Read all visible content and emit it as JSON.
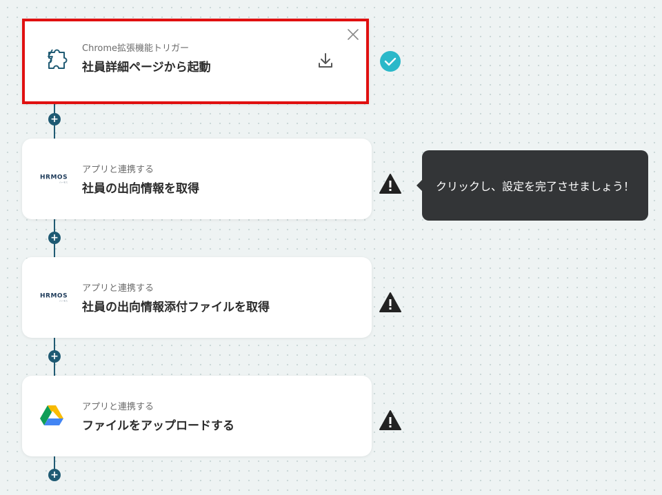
{
  "trigger": {
    "subtitle": "Chrome拡張機能トリガー",
    "title": "社員詳細ページから起動",
    "status": "complete"
  },
  "steps": [
    {
      "subtitle": "アプリと連携する",
      "title": "社員の出向情報を取得",
      "app": "HRMOS",
      "app_sub": "ハーモス",
      "status": "warning"
    },
    {
      "subtitle": "アプリと連携する",
      "title": "社員の出向情報添付ファイルを取得",
      "app": "HRMOS",
      "app_sub": "ハーモス",
      "status": "warning"
    },
    {
      "subtitle": "アプリと連携する",
      "title": "ファイルをアップロードする",
      "app": "google-drive-icon",
      "status": "warning"
    }
  ],
  "tooltip": {
    "text": "クリックし、設定を完了させましょう！"
  },
  "icons": {
    "trigger": "puzzle-lightning-icon",
    "download": "download-icon",
    "close": "close-icon",
    "complete": "check-circle-icon",
    "warning": "warning-icon",
    "add": "plus-icon"
  },
  "colors": {
    "line": "#1f5a73",
    "selected_border": "#e01010",
    "check": "#2bb8c9",
    "warning": "#222222",
    "tooltip_bg": "#333537"
  }
}
